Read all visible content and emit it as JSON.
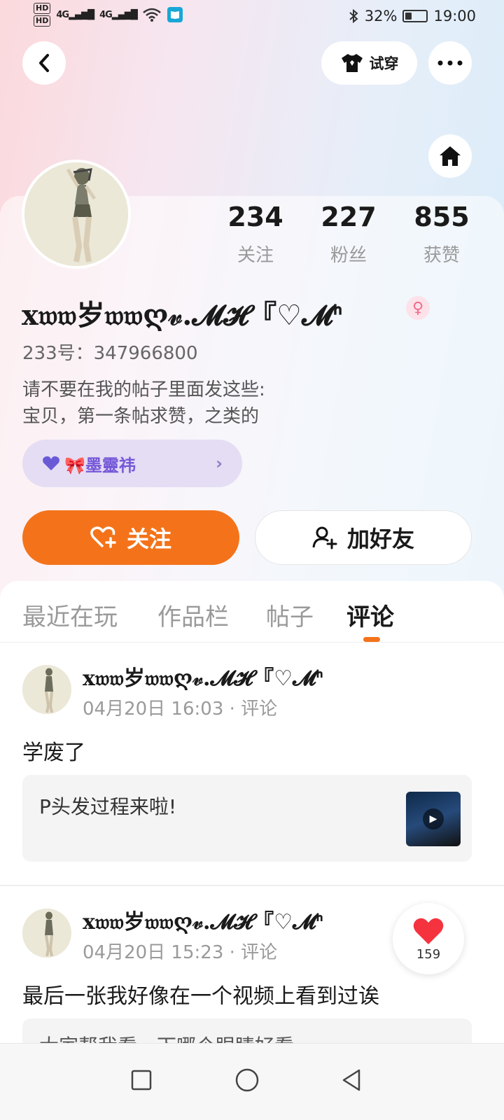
{
  "status_bar": {
    "hd1": "HD",
    "hd2": "HD",
    "net1": "4G",
    "net2": "4G",
    "battery_percent": "32%",
    "battery_level": 0.32,
    "time": "19:00"
  },
  "header": {
    "try_on_label": "试穿"
  },
  "profile": {
    "username": "x𝔴𝔴岁𝔴𝔴ღ𝓋.𝓜𝓗『♡𝓜ᑋ",
    "uid": "233号：347966800",
    "bio_line1": "请不要在我的帖子里面发这些:",
    "bio_line2": "宝贝，第一条帖求赞，之类的",
    "gender_symbol": "♀",
    "medal_text": "🎀墨靈祎",
    "stats": [
      {
        "num": "234",
        "label": "关注"
      },
      {
        "num": "227",
        "label": "粉丝"
      },
      {
        "num": "855",
        "label": "获赞"
      }
    ]
  },
  "actions": {
    "follow_label": "关注",
    "add_friend_label": "加好友"
  },
  "tabs": [
    {
      "label": "最近在玩"
    },
    {
      "label": "作品栏"
    },
    {
      "label": "帖子"
    },
    {
      "label": "评论"
    }
  ],
  "posts": [
    {
      "name": "x𝔴𝔴岁𝔴𝔴ღ𝓋.𝓜𝓗『♡𝓜ᑋ",
      "meta": "04月20日 16:03 · 评论",
      "text": "学废了",
      "quote": "P头发过程来啦!"
    },
    {
      "name": "x𝔴𝔴岁𝔴𝔴ღ𝓋.𝓜𝓗『♡𝓜ᑋ",
      "meta": "04月20日 15:23 · 评论",
      "text": "最后一张我好像在一个视频上看到过诶",
      "quote": "大家帮我看一下哪个眼睛好看"
    }
  ],
  "like": {
    "count": "159",
    "color": "#f5333f"
  },
  "colors": {
    "accent": "#f4731a",
    "medal_bg": "#e4ddf4"
  }
}
